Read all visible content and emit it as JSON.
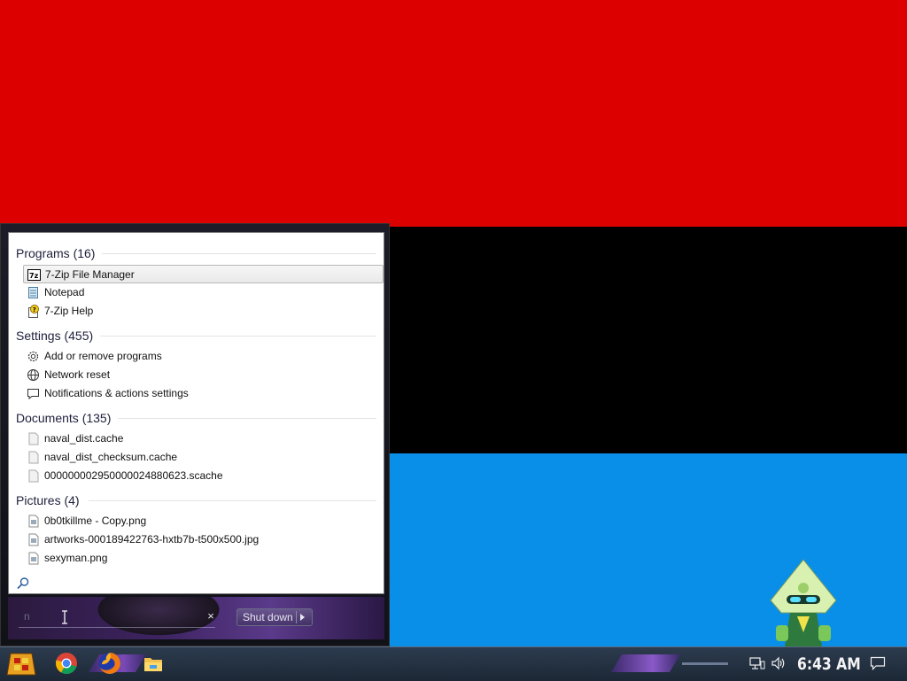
{
  "start_menu": {
    "groups": [
      {
        "title": "Programs (16)",
        "items": [
          {
            "label": "7-Zip File Manager",
            "icon": "7zip-icon",
            "selected": true
          },
          {
            "label": "Notepad",
            "icon": "notepad-icon"
          },
          {
            "label": "7-Zip Help",
            "icon": "help-file-icon"
          }
        ]
      },
      {
        "title": "Settings (455)",
        "items": [
          {
            "label": "Add or remove programs",
            "icon": "gear-icon"
          },
          {
            "label": "Network reset",
            "icon": "globe-icon"
          },
          {
            "label": "Notifications & actions settings",
            "icon": "notification-icon"
          }
        ]
      },
      {
        "title": "Documents (135)",
        "items": [
          {
            "label": "naval_dist.cache",
            "icon": "file-icon"
          },
          {
            "label": "naval_dist_checksum.cache",
            "icon": "file-icon"
          },
          {
            "label": "000000002950000024880623.scache",
            "icon": "file-icon"
          }
        ]
      },
      {
        "title": "Pictures (4)",
        "items": [
          {
            "label": "0b0tkillme - Copy.png",
            "icon": "image-file-icon"
          },
          {
            "label": "artworks-000189422763-hxtb7b-t500x500.jpg",
            "icon": "image-file-icon"
          },
          {
            "label": "sexyman.png",
            "icon": "image-file-icon"
          }
        ]
      }
    ],
    "search": {
      "value": "n",
      "clear_glyph": "×"
    },
    "shutdown_label": "Shut down"
  },
  "taskbar": {
    "apps": [
      "start-orb-icon",
      "chrome-icon",
      "firefox-icon",
      "file-explorer-icon"
    ],
    "tray": [
      "network-icon",
      "volume-icon",
      "action-center-icon"
    ],
    "clock": "6:43 AM"
  },
  "colors": {
    "wallpaper_top": "#dc0000",
    "wallpaper_middle": "#000000",
    "wallpaper_bottom": "#0a8fe8",
    "taskbar": "#243244",
    "accent_purple": "#7a4ab8"
  }
}
